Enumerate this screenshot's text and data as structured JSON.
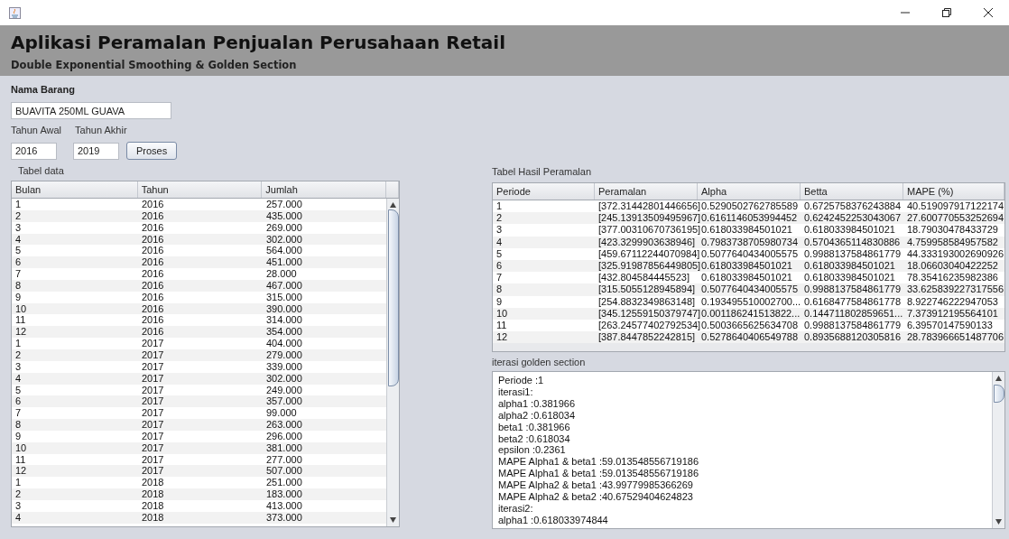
{
  "header": {
    "title": "Aplikasi Peramalan Penjualan Perusahaan Retail",
    "subtitle": "Double Exponential Smoothing & Golden Section"
  },
  "form": {
    "nama_barang_label": "Nama Barang",
    "nama_barang_value": "BUAVITA 250ML GUAVA",
    "tahun_awal_label": "Tahun Awal",
    "tahun_akhir_label": "Tahun Akhir",
    "tahun_awal_value": "2016",
    "tahun_akhir_value": "2019",
    "proses_button": "Proses"
  },
  "data_table": {
    "label": "Tabel data",
    "columns": [
      "Bulan",
      "Tahun",
      "Jumlah"
    ],
    "rows": [
      [
        "1",
        "2016",
        "257.000"
      ],
      [
        "2",
        "2016",
        "435.000"
      ],
      [
        "3",
        "2016",
        "269.000"
      ],
      [
        "4",
        "2016",
        "302.000"
      ],
      [
        "5",
        "2016",
        "564.000"
      ],
      [
        "6",
        "2016",
        "451.000"
      ],
      [
        "7",
        "2016",
        "28.000"
      ],
      [
        "8",
        "2016",
        "467.000"
      ],
      [
        "9",
        "2016",
        "315.000"
      ],
      [
        "10",
        "2016",
        "390.000"
      ],
      [
        "11",
        "2016",
        "314.000"
      ],
      [
        "12",
        "2016",
        "354.000"
      ],
      [
        "1",
        "2017",
        "404.000"
      ],
      [
        "2",
        "2017",
        "279.000"
      ],
      [
        "3",
        "2017",
        "339.000"
      ],
      [
        "4",
        "2017",
        "302.000"
      ],
      [
        "5",
        "2017",
        "249.000"
      ],
      [
        "6",
        "2017",
        "357.000"
      ],
      [
        "7",
        "2017",
        "99.000"
      ],
      [
        "8",
        "2017",
        "263.000"
      ],
      [
        "9",
        "2017",
        "296.000"
      ],
      [
        "10",
        "2017",
        "381.000"
      ],
      [
        "11",
        "2017",
        "277.000"
      ],
      [
        "12",
        "2017",
        "507.000"
      ],
      [
        "1",
        "2018",
        "251.000"
      ],
      [
        "2",
        "2018",
        "183.000"
      ],
      [
        "3",
        "2018",
        "413.000"
      ],
      [
        "4",
        "2018",
        "373.000"
      ]
    ]
  },
  "result_table": {
    "label": "Tabel Hasil Peramalan",
    "columns": [
      "Periode",
      "Peramalan",
      "Alpha",
      "Betta",
      "MAPE (%)"
    ],
    "rows": [
      [
        "1",
        "[372.31442801446656]",
        "0.5290502762785589",
        "0.6725758376243884",
        "40.519097917122174"
      ],
      [
        "2",
        "[245.13913509495967]",
        "0.6161146053994452",
        "0.6242452253043067",
        "27.600770553252694"
      ],
      [
        "3",
        "[377.00310670736195]",
        "0.618033984501021",
        "0.618033984501021",
        "18.79030478433729"
      ],
      [
        "4",
        "[423.3299903638946]",
        "0.7983738705980734",
        "0.5704365114830886",
        "4.759958584957582"
      ],
      [
        "5",
        "[459.67112244070984]",
        "0.5077640434005575",
        "0.9988137584861779",
        "44.333193002690926"
      ],
      [
        "6",
        "[325.91987856449805]",
        "0.618033984501021",
        "0.618033984501021",
        "18.06603040422252"
      ],
      [
        "7",
        "[432.804584445523]",
        "0.618033984501021",
        "0.618033984501021",
        "78.35416235982386"
      ],
      [
        "8",
        "[315.5055128945894]",
        "0.5077640434005575",
        "0.9988137584861779",
        "33.625839227317556"
      ],
      [
        "9",
        "[254.8832349863148]",
        "0.193495510002700...",
        "0.6168477584861778",
        "8.922746222947053"
      ],
      [
        "10",
        "[345.12559150379747]",
        "0.001186241513822...",
        "0.144711802859651...",
        "7.373912195564101"
      ],
      [
        "11",
        "[263.24577402792534]",
        "0.5003665625634708",
        "0.9988137584861779",
        "6.39570147590133"
      ],
      [
        "12",
        "[387.8447852242815]",
        "0.5278640406549788",
        "0.8935688120305816",
        "28.783966651487706"
      ]
    ]
  },
  "iteration_log": {
    "label": "iterasi golden section",
    "lines": [
      "Periode :1",
      "iterasi1:",
      "alpha1 :0.381966",
      "alpha2 :0.618034",
      "beta1 :0.381966",
      "beta2 :0.618034",
      "epsilon :0.2361",
      "MAPE Alpha1 & beta1 :59.013548556719186",
      "MAPE Alpha1 & beta1 :59.013548556719186",
      "MAPE Alpha2 & beta1 :43.99779985366269",
      "MAPE Alpha2 & beta2 :40.67529404624823",
      "iterasi2:",
      "alpha1 :0.618033974844"
    ]
  }
}
